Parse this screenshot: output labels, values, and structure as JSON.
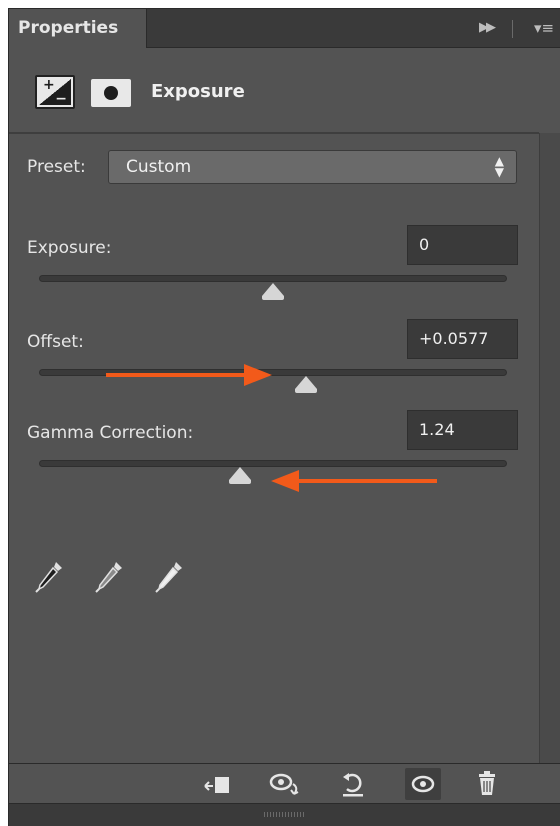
{
  "panel": {
    "tab_label": "Properties",
    "menu_icons": [
      "collapse-icon",
      "panel-menu-icon"
    ]
  },
  "header": {
    "title": "Exposure",
    "icons": [
      "adjustment-layer-icon",
      "layer-mask-icon"
    ]
  },
  "preset": {
    "label": "Preset:",
    "value": "Custom"
  },
  "controls": [
    {
      "label": "Exposure:",
      "value": "0",
      "slider_fraction": 0.5
    },
    {
      "label": "Offset:",
      "value": "+0.0577",
      "slider_fraction": 0.57
    },
    {
      "label": "Gamma Correction:",
      "value": "1.24",
      "slider_fraction": 0.43
    }
  ],
  "annotations": {
    "color": "#f25a1a",
    "offset_arrow_direction": "right",
    "gamma_arrow_direction": "left"
  },
  "eyedroppers": [
    "black-point-eyedropper-icon",
    "gray-point-eyedropper-icon",
    "white-point-eyedropper-icon"
  ],
  "toolbar": {
    "buttons": [
      "clip-to-layer-icon",
      "view-previous-state-icon",
      "reset-icon",
      "toggle-visibility-icon",
      "delete-icon"
    ]
  },
  "colors": {
    "panel_bg": "#535353",
    "dark_bg": "#3a3a3a",
    "text": "#e6e6e6",
    "accent": "#f25a1a"
  }
}
